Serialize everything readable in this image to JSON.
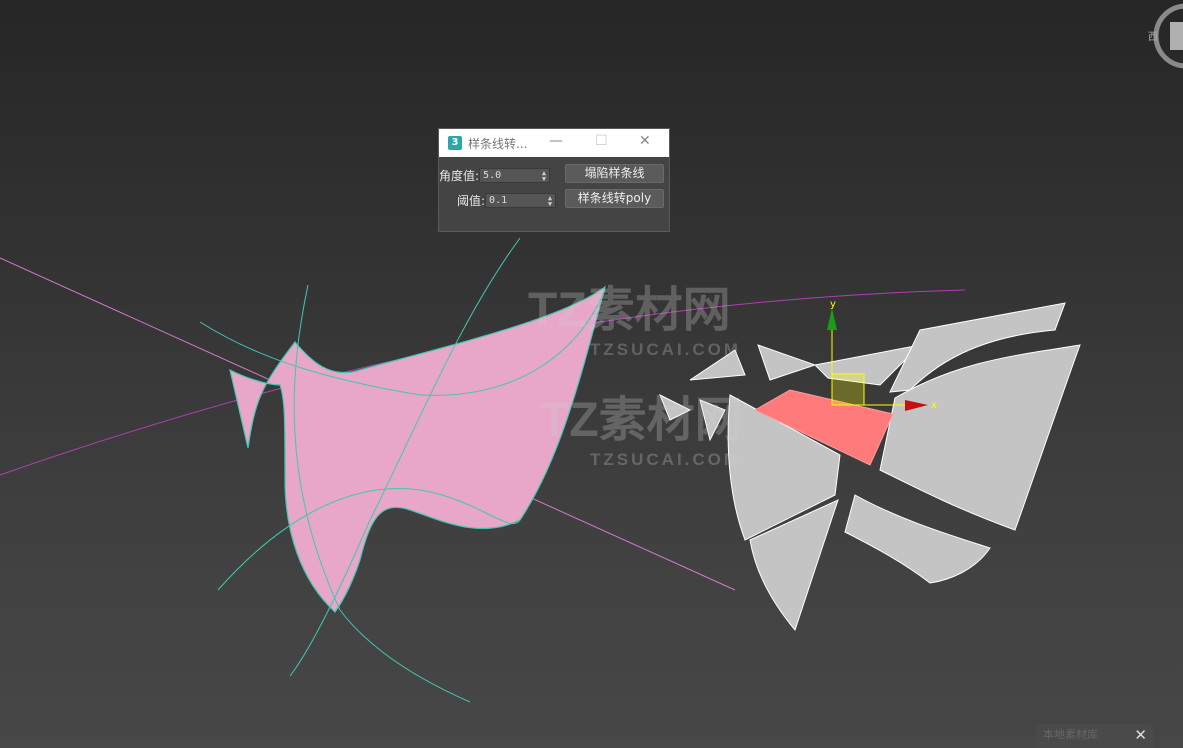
{
  "dialog": {
    "title": "样条线转...",
    "angle_label": "角度值:",
    "angle_value": "5.0",
    "threshold_label": "阈值:",
    "threshold_value": "0.1",
    "collapse_button": "塌陷样条线",
    "convert_button": "样条线转poly",
    "app_icon": "3"
  },
  "viewport": {
    "gizmo_y": "y",
    "gizmo_x": "x",
    "viewcube_label": "西"
  },
  "watermark": {
    "brand": "TZ素材网",
    "url": "TZSUCAI.COM"
  },
  "bottom_tab": {
    "label": "本地素材库",
    "close": "✕"
  },
  "colors": {
    "surface": "#e8a6c8",
    "selected": "#ff7a7a",
    "pieces": "#c4c4c4",
    "spline_cyan": "#3fc8b0",
    "spline_magenta": "#c040c0"
  }
}
